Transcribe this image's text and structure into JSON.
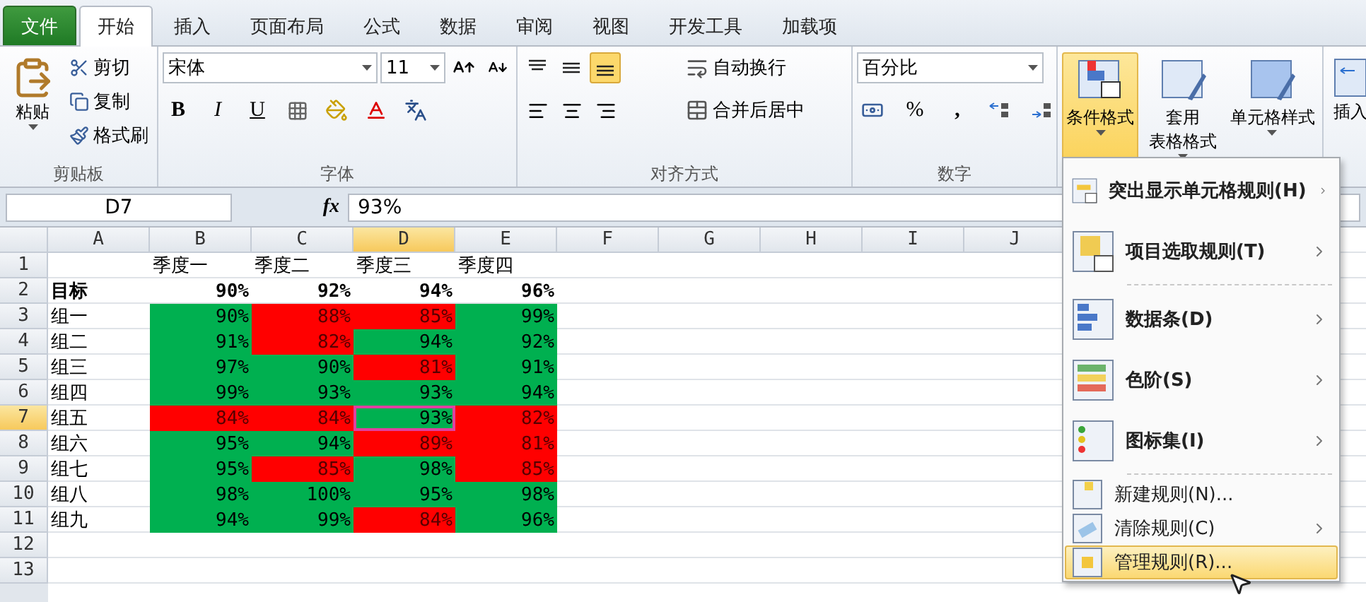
{
  "tabs": [
    {
      "label": "文件",
      "kind": "file",
      "selected": false
    },
    {
      "label": "开始",
      "kind": "tab",
      "selected": true
    },
    {
      "label": "插入",
      "kind": "tab",
      "selected": false
    },
    {
      "label": "页面布局",
      "kind": "tab",
      "selected": false
    },
    {
      "label": "公式",
      "kind": "tab",
      "selected": false
    },
    {
      "label": "数据",
      "kind": "tab",
      "selected": false
    },
    {
      "label": "审阅",
      "kind": "tab",
      "selected": false
    },
    {
      "label": "视图",
      "kind": "tab",
      "selected": false
    },
    {
      "label": "开发工具",
      "kind": "tab",
      "selected": false
    },
    {
      "label": "加载项",
      "kind": "tab",
      "selected": false
    }
  ],
  "clipboard": {
    "paste": "粘贴",
    "items": [
      "剪切",
      "复制",
      "格式刷"
    ],
    "label": "剪贴板"
  },
  "font": {
    "name": "宋体",
    "size": "11",
    "bold": "B",
    "italic": "I",
    "underline": "U",
    "label": "字体"
  },
  "alignment": {
    "wrap": "自动换行",
    "merge": "合并后居中",
    "label": "对齐方式"
  },
  "number": {
    "format": "百分比",
    "percent": "%",
    "comma": ",",
    "label": "数字"
  },
  "styles": [
    {
      "lines": [
        "条件格式"
      ],
      "selected": true
    },
    {
      "lines": [
        "套用",
        "表格格式"
      ],
      "selected": false
    },
    {
      "lines": [
        "单元格样式"
      ],
      "selected": false
    }
  ],
  "cells_group": {
    "label": "插入"
  },
  "formula_bar": {
    "name_box": "D7",
    "fx": "fx",
    "value": "93%"
  },
  "columns": [
    {
      "label": "A",
      "selected": false
    },
    {
      "label": "B",
      "selected": false
    },
    {
      "label": "C",
      "selected": false
    },
    {
      "label": "D",
      "selected": true
    },
    {
      "label": "E",
      "selected": false
    },
    {
      "label": "F",
      "selected": false
    },
    {
      "label": "G",
      "selected": false
    },
    {
      "label": "H",
      "selected": false
    },
    {
      "label": "I",
      "selected": false
    },
    {
      "label": "J",
      "selected": false
    }
  ],
  "rows": [
    {
      "header": "1",
      "kind": "header",
      "selected": false,
      "values": [
        {
          "text": "季度一"
        },
        {
          "text": "季度二"
        },
        {
          "text": "季度三"
        },
        {
          "text": "季度四"
        }
      ]
    },
    {
      "header": "2",
      "kind": "target",
      "label": "目标",
      "selected": false,
      "values": [
        {
          "text": "90%"
        },
        {
          "text": "92%"
        },
        {
          "text": "94%"
        },
        {
          "text": "96%"
        }
      ]
    },
    {
      "header": "3",
      "kind": "data",
      "label": "组一",
      "selected": false,
      "values": [
        {
          "text": "90%",
          "color": "#00b050"
        },
        {
          "text": "88%",
          "color": "#ff0000"
        },
        {
          "text": "85%",
          "color": "#ff0000"
        },
        {
          "text": "99%",
          "color": "#00b050"
        }
      ]
    },
    {
      "header": "4",
      "kind": "data",
      "label": "组二",
      "selected": false,
      "values": [
        {
          "text": "91%",
          "color": "#00b050"
        },
        {
          "text": "82%",
          "color": "#ff0000"
        },
        {
          "text": "94%",
          "color": "#00b050"
        },
        {
          "text": "92%",
          "color": "#00b050"
        }
      ]
    },
    {
      "header": "5",
      "kind": "data",
      "label": "组三",
      "selected": false,
      "values": [
        {
          "text": "97%",
          "color": "#00b050"
        },
        {
          "text": "90%",
          "color": "#00b050"
        },
        {
          "text": "81%",
          "color": "#ff0000"
        },
        {
          "text": "91%",
          "color": "#00b050"
        }
      ]
    },
    {
      "header": "6",
      "kind": "data",
      "label": "组四",
      "selected": false,
      "values": [
        {
          "text": "99%",
          "color": "#00b050"
        },
        {
          "text": "93%",
          "color": "#00b050"
        },
        {
          "text": "93%",
          "color": "#00b050"
        },
        {
          "text": "94%",
          "color": "#00b050"
        }
      ]
    },
    {
      "header": "7",
      "kind": "data",
      "label": "组五",
      "selected": true,
      "values": [
        {
          "text": "84%",
          "color": "#ff0000"
        },
        {
          "text": "84%",
          "color": "#ff0000"
        },
        {
          "text": "93%",
          "color": "#00b050",
          "selected": true
        },
        {
          "text": "82%",
          "color": "#ff0000"
        }
      ]
    },
    {
      "header": "8",
      "kind": "data",
      "label": "组六",
      "selected": false,
      "values": [
        {
          "text": "95%",
          "color": "#00b050"
        },
        {
          "text": "94%",
          "color": "#00b050"
        },
        {
          "text": "89%",
          "color": "#ff0000"
        },
        {
          "text": "81%",
          "color": "#ff0000"
        }
      ]
    },
    {
      "header": "9",
      "kind": "data",
      "label": "组七",
      "selected": false,
      "values": [
        {
          "text": "95%",
          "color": "#00b050"
        },
        {
          "text": "85%",
          "color": "#ff0000"
        },
        {
          "text": "98%",
          "color": "#00b050"
        },
        {
          "text": "85%",
          "color": "#ff0000"
        }
      ]
    },
    {
      "header": "10",
      "kind": "data",
      "label": "组八",
      "selected": false,
      "values": [
        {
          "text": "98%",
          "color": "#00b050"
        },
        {
          "text": "100%",
          "color": "#00b050"
        },
        {
          "text": "95%",
          "color": "#00b050"
        },
        {
          "text": "98%",
          "color": "#00b050"
        }
      ]
    },
    {
      "header": "11",
      "kind": "data",
      "label": "组九",
      "selected": false,
      "values": [
        {
          "text": "94%",
          "color": "#00b050"
        },
        {
          "text": "99%",
          "color": "#00b050"
        },
        {
          "text": "84%",
          "color": "#ff0000"
        },
        {
          "text": "96%",
          "color": "#00b050"
        }
      ]
    },
    {
      "header": "12",
      "selected": false
    },
    {
      "header": "13",
      "selected": false
    }
  ],
  "menu": [
    {
      "label": "突出显示单元格规则(H)",
      "kind": "large",
      "submenu": true,
      "selected": false
    },
    {
      "label": "项目选取规则(T)",
      "kind": "large",
      "submenu": true,
      "selected": false
    },
    {
      "kind": "separator"
    },
    {
      "label": "数据条(D)",
      "kind": "large",
      "submenu": true,
      "selected": false
    },
    {
      "label": "色阶(S)",
      "kind": "large",
      "submenu": true,
      "selected": false
    },
    {
      "label": "图标集(I)",
      "kind": "large",
      "submenu": true,
      "selected": false
    },
    {
      "kind": "separator"
    },
    {
      "label": "新建规则(N)...",
      "kind": "small",
      "submenu": false,
      "selected": false
    },
    {
      "label": "清除规则(C)",
      "kind": "small",
      "submenu": true,
      "selected": false
    },
    {
      "label": "管理规则(R)...",
      "kind": "small",
      "submenu": false,
      "selected": true
    }
  ]
}
